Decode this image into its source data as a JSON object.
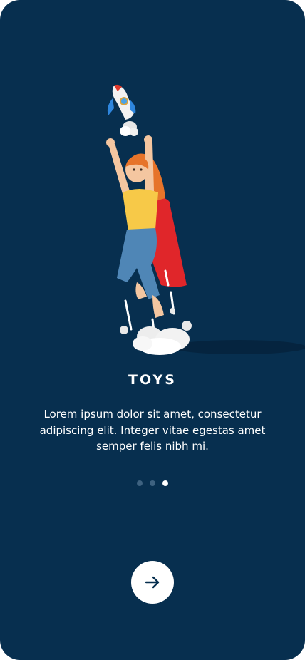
{
  "onboarding": {
    "title": "TOYS",
    "description": "Lorem ipsum dolor sit amet, consectetur adipiscing elit. Integer vitae egestas amet semper felis nibh mi.",
    "page_indicator": {
      "total": 3,
      "current": 3
    },
    "next_button_icon": "arrow-right-icon"
  },
  "colors": {
    "background": "#072f4f",
    "dot_inactive": "#3e6280",
    "dot_active": "#ffffff",
    "button": "#ffffff",
    "button_icon": "#072f4f"
  }
}
